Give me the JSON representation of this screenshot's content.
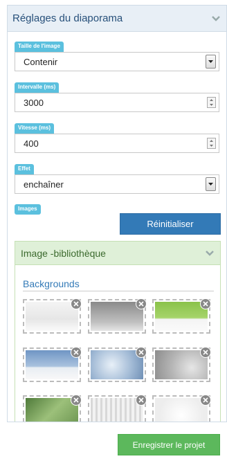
{
  "panel": {
    "title": "Réglages du diaporama",
    "collapse_icon": "chevron-down-icon"
  },
  "image_size": {
    "label": "Taille de l'image",
    "value": "Contenir"
  },
  "interval": {
    "label": "Intervalle (ms)",
    "value": "3000"
  },
  "speed": {
    "label": "Vitesse (ms)",
    "value": "400"
  },
  "effect": {
    "label": "Effet",
    "value": "enchaîner"
  },
  "images": {
    "label": "Images",
    "reset_label": "Réinitialiser"
  },
  "library": {
    "title": "Image -bibliothèque",
    "collapse_icon": "chevron-down-icon",
    "section": "Backgrounds",
    "thumbnails": [
      {
        "name": "white-fade",
        "remove_icon": "remove-circle-icon"
      },
      {
        "name": "grey-gradient",
        "remove_icon": "remove-circle-icon"
      },
      {
        "name": "green-gradient",
        "remove_icon": "remove-circle-icon"
      },
      {
        "name": "blue-sky",
        "remove_icon": "remove-circle-icon"
      },
      {
        "name": "clouds",
        "remove_icon": "remove-circle-icon"
      },
      {
        "name": "grey-burst",
        "remove_icon": "remove-circle-icon"
      },
      {
        "name": "green-texture",
        "remove_icon": "remove-circle-icon"
      },
      {
        "name": "building",
        "remove_icon": "remove-circle-icon"
      },
      {
        "name": "white-light",
        "remove_icon": "remove-circle-icon"
      }
    ]
  },
  "save_label": "Enregistrer le projet"
}
